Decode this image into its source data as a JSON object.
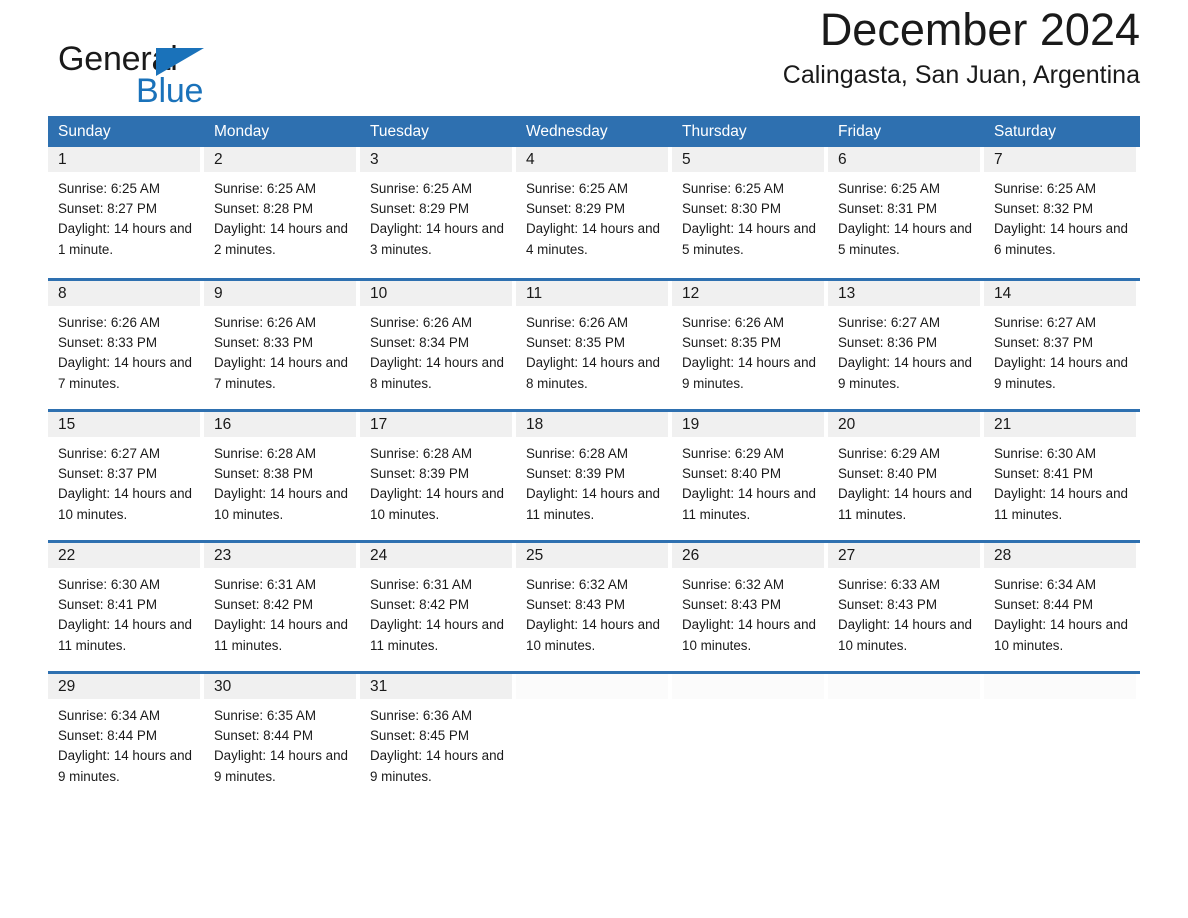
{
  "brand": {
    "name_part1": "General",
    "name_part2": "Blue",
    "logo_icon": "triangle-flag-icon",
    "accent_color": "#1a72ba"
  },
  "header": {
    "month_title": "December 2024",
    "location": "Calingasta, San Juan, Argentina"
  },
  "theme": {
    "header_blue": "#2e70b0",
    "daynum_gray": "#f0f0f0",
    "text_color": "#1a1a1a"
  },
  "weekdays": [
    "Sunday",
    "Monday",
    "Tuesday",
    "Wednesday",
    "Thursday",
    "Friday",
    "Saturday"
  ],
  "weeks": [
    [
      {
        "day": "1",
        "sunrise": "Sunrise: 6:25 AM",
        "sunset": "Sunset: 8:27 PM",
        "daylight": "Daylight: 14 hours and 1 minute."
      },
      {
        "day": "2",
        "sunrise": "Sunrise: 6:25 AM",
        "sunset": "Sunset: 8:28 PM",
        "daylight": "Daylight: 14 hours and 2 minutes."
      },
      {
        "day": "3",
        "sunrise": "Sunrise: 6:25 AM",
        "sunset": "Sunset: 8:29 PM",
        "daylight": "Daylight: 14 hours and 3 minutes."
      },
      {
        "day": "4",
        "sunrise": "Sunrise: 6:25 AM",
        "sunset": "Sunset: 8:29 PM",
        "daylight": "Daylight: 14 hours and 4 minutes."
      },
      {
        "day": "5",
        "sunrise": "Sunrise: 6:25 AM",
        "sunset": "Sunset: 8:30 PM",
        "daylight": "Daylight: 14 hours and 5 minutes."
      },
      {
        "day": "6",
        "sunrise": "Sunrise: 6:25 AM",
        "sunset": "Sunset: 8:31 PM",
        "daylight": "Daylight: 14 hours and 5 minutes."
      },
      {
        "day": "7",
        "sunrise": "Sunrise: 6:25 AM",
        "sunset": "Sunset: 8:32 PM",
        "daylight": "Daylight: 14 hours and 6 minutes."
      }
    ],
    [
      {
        "day": "8",
        "sunrise": "Sunrise: 6:26 AM",
        "sunset": "Sunset: 8:33 PM",
        "daylight": "Daylight: 14 hours and 7 minutes."
      },
      {
        "day": "9",
        "sunrise": "Sunrise: 6:26 AM",
        "sunset": "Sunset: 8:33 PM",
        "daylight": "Daylight: 14 hours and 7 minutes."
      },
      {
        "day": "10",
        "sunrise": "Sunrise: 6:26 AM",
        "sunset": "Sunset: 8:34 PM",
        "daylight": "Daylight: 14 hours and 8 minutes."
      },
      {
        "day": "11",
        "sunrise": "Sunrise: 6:26 AM",
        "sunset": "Sunset: 8:35 PM",
        "daylight": "Daylight: 14 hours and 8 minutes."
      },
      {
        "day": "12",
        "sunrise": "Sunrise: 6:26 AM",
        "sunset": "Sunset: 8:35 PM",
        "daylight": "Daylight: 14 hours and 9 minutes."
      },
      {
        "day": "13",
        "sunrise": "Sunrise: 6:27 AM",
        "sunset": "Sunset: 8:36 PM",
        "daylight": "Daylight: 14 hours and 9 minutes."
      },
      {
        "day": "14",
        "sunrise": "Sunrise: 6:27 AM",
        "sunset": "Sunset: 8:37 PM",
        "daylight": "Daylight: 14 hours and 9 minutes."
      }
    ],
    [
      {
        "day": "15",
        "sunrise": "Sunrise: 6:27 AM",
        "sunset": "Sunset: 8:37 PM",
        "daylight": "Daylight: 14 hours and 10 minutes."
      },
      {
        "day": "16",
        "sunrise": "Sunrise: 6:28 AM",
        "sunset": "Sunset: 8:38 PM",
        "daylight": "Daylight: 14 hours and 10 minutes."
      },
      {
        "day": "17",
        "sunrise": "Sunrise: 6:28 AM",
        "sunset": "Sunset: 8:39 PM",
        "daylight": "Daylight: 14 hours and 10 minutes."
      },
      {
        "day": "18",
        "sunrise": "Sunrise: 6:28 AM",
        "sunset": "Sunset: 8:39 PM",
        "daylight": "Daylight: 14 hours and 11 minutes."
      },
      {
        "day": "19",
        "sunrise": "Sunrise: 6:29 AM",
        "sunset": "Sunset: 8:40 PM",
        "daylight": "Daylight: 14 hours and 11 minutes."
      },
      {
        "day": "20",
        "sunrise": "Sunrise: 6:29 AM",
        "sunset": "Sunset: 8:40 PM",
        "daylight": "Daylight: 14 hours and 11 minutes."
      },
      {
        "day": "21",
        "sunrise": "Sunrise: 6:30 AM",
        "sunset": "Sunset: 8:41 PM",
        "daylight": "Daylight: 14 hours and 11 minutes."
      }
    ],
    [
      {
        "day": "22",
        "sunrise": "Sunrise: 6:30 AM",
        "sunset": "Sunset: 8:41 PM",
        "daylight": "Daylight: 14 hours and 11 minutes."
      },
      {
        "day": "23",
        "sunrise": "Sunrise: 6:31 AM",
        "sunset": "Sunset: 8:42 PM",
        "daylight": "Daylight: 14 hours and 11 minutes."
      },
      {
        "day": "24",
        "sunrise": "Sunrise: 6:31 AM",
        "sunset": "Sunset: 8:42 PM",
        "daylight": "Daylight: 14 hours and 11 minutes."
      },
      {
        "day": "25",
        "sunrise": "Sunrise: 6:32 AM",
        "sunset": "Sunset: 8:43 PM",
        "daylight": "Daylight: 14 hours and 10 minutes."
      },
      {
        "day": "26",
        "sunrise": "Sunrise: 6:32 AM",
        "sunset": "Sunset: 8:43 PM",
        "daylight": "Daylight: 14 hours and 10 minutes."
      },
      {
        "day": "27",
        "sunrise": "Sunrise: 6:33 AM",
        "sunset": "Sunset: 8:43 PM",
        "daylight": "Daylight: 14 hours and 10 minutes."
      },
      {
        "day": "28",
        "sunrise": "Sunrise: 6:34 AM",
        "sunset": "Sunset: 8:44 PM",
        "daylight": "Daylight: 14 hours and 10 minutes."
      }
    ],
    [
      {
        "day": "29",
        "sunrise": "Sunrise: 6:34 AM",
        "sunset": "Sunset: 8:44 PM",
        "daylight": "Daylight: 14 hours and 9 minutes."
      },
      {
        "day": "30",
        "sunrise": "Sunrise: 6:35 AM",
        "sunset": "Sunset: 8:44 PM",
        "daylight": "Daylight: 14 hours and 9 minutes."
      },
      {
        "day": "31",
        "sunrise": "Sunrise: 6:36 AM",
        "sunset": "Sunset: 8:45 PM",
        "daylight": "Daylight: 14 hours and 9 minutes."
      },
      {
        "day": "",
        "sunrise": "",
        "sunset": "",
        "daylight": ""
      },
      {
        "day": "",
        "sunrise": "",
        "sunset": "",
        "daylight": ""
      },
      {
        "day": "",
        "sunrise": "",
        "sunset": "",
        "daylight": ""
      },
      {
        "day": "",
        "sunrise": "",
        "sunset": "",
        "daylight": ""
      }
    ]
  ]
}
